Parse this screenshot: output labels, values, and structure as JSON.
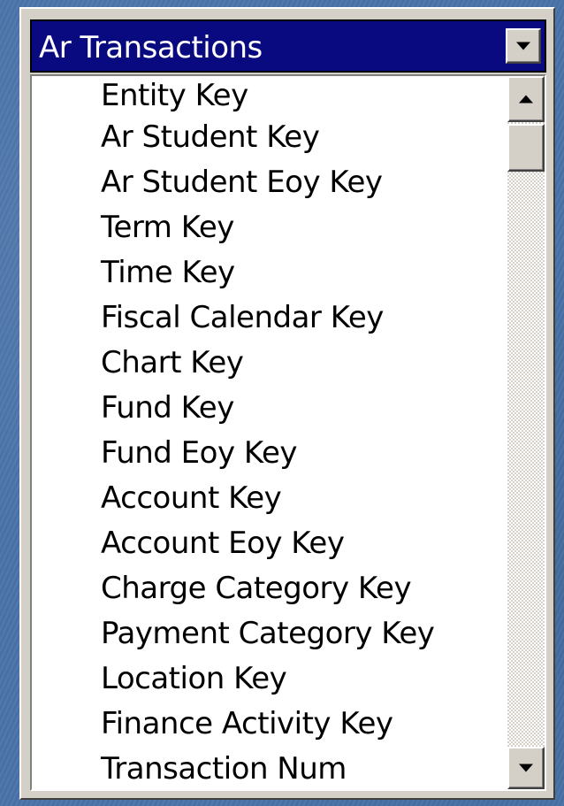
{
  "combo": {
    "selected": "Ar Transactions",
    "dropdown_icon": "chevron-down-icon"
  },
  "list": {
    "items": [
      {
        "label": "Entity Key"
      },
      {
        "label": "Ar Student Key"
      },
      {
        "label": "Ar Student Eoy Key"
      },
      {
        "label": "Term Key"
      },
      {
        "label": "Time Key"
      },
      {
        "label": "Fiscal Calendar Key"
      },
      {
        "label": "Chart Key"
      },
      {
        "label": "Fund Key"
      },
      {
        "label": "Fund Eoy Key"
      },
      {
        "label": "Account Key"
      },
      {
        "label": "Account Eoy Key"
      },
      {
        "label": "Charge Category Key"
      },
      {
        "label": "Payment Category Key"
      },
      {
        "label": "Location Key"
      },
      {
        "label": "Finance Activity Key"
      },
      {
        "label": "Transaction Num"
      }
    ]
  },
  "scrollbar": {
    "up_icon": "arrow-up-icon",
    "down_icon": "arrow-down-icon",
    "position": 0
  },
  "colors": {
    "background": "#4a74aa",
    "selection": "#0a0a80",
    "face": "#d4d0c8"
  }
}
